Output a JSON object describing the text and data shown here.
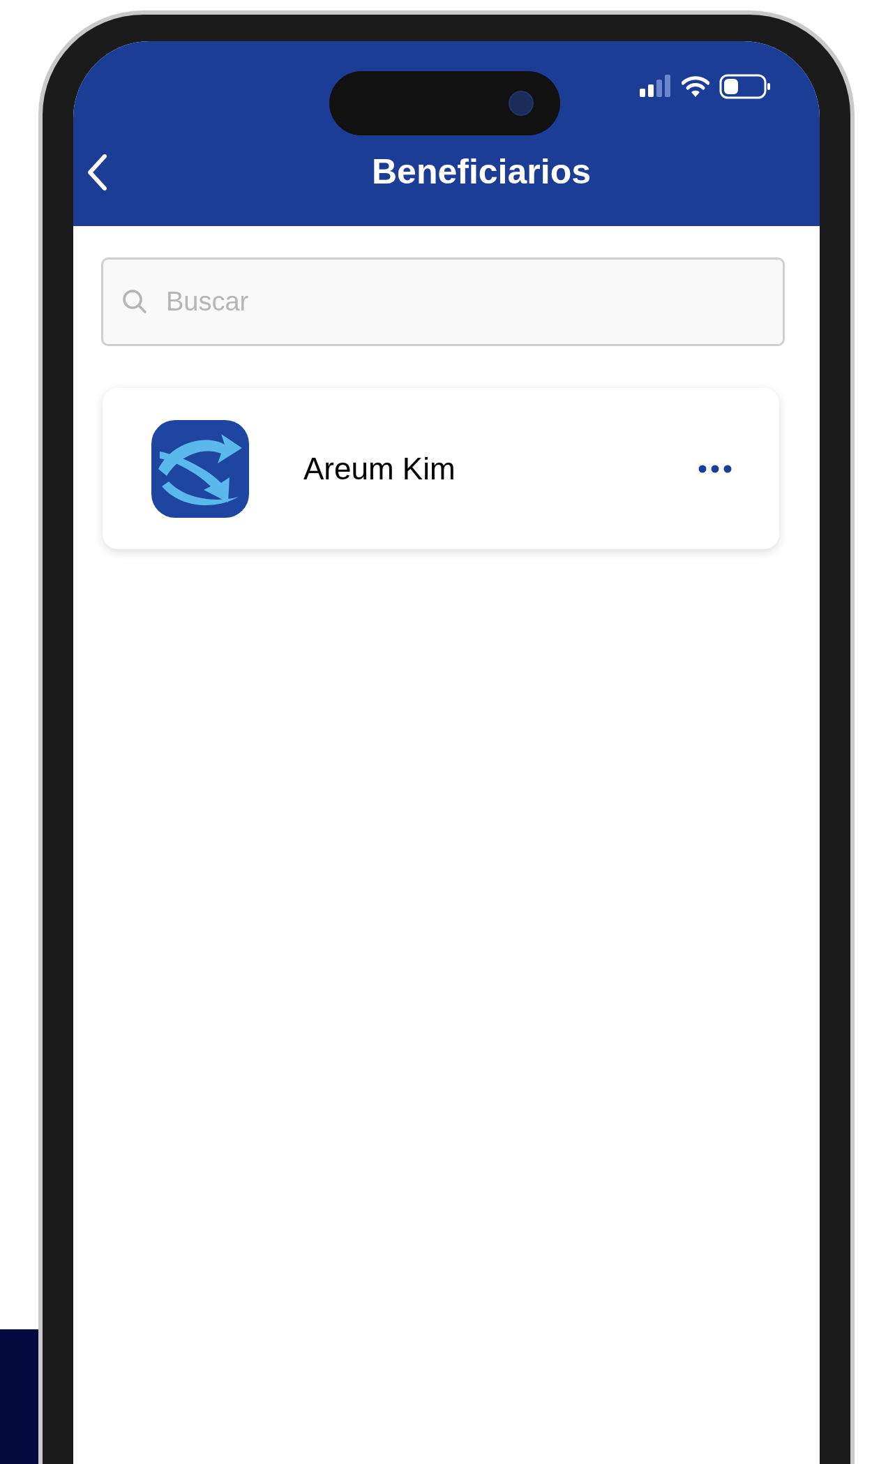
{
  "header": {
    "title": "Beneficiarios"
  },
  "search": {
    "placeholder": "Buscar"
  },
  "beneficiaries": [
    {
      "name": "Areum Kim"
    }
  ]
}
